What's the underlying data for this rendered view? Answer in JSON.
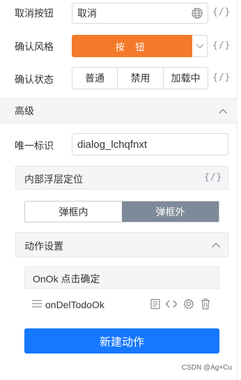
{
  "cancel_row": {
    "label": "取消按钮",
    "value": "取消",
    "globe_icon": "globe-icon",
    "code_icon": "{/}"
  },
  "style_row": {
    "label": "确认风格",
    "button_text": "按 钮",
    "code_icon": "{/}",
    "button_color": "#f47a2a"
  },
  "state_row": {
    "label": "确认状态",
    "options": [
      "普通",
      "禁用",
      "加载中"
    ],
    "code_icon": "{/}"
  },
  "advanced": {
    "title": "高级"
  },
  "uid_row": {
    "label": "唯一标识",
    "value": "dialog_lchqfnxt"
  },
  "float_panel": {
    "title": "内部浮层定位",
    "code_icon": "{/}",
    "options": [
      "弹框内",
      "弹框外"
    ],
    "selected": "弹框外"
  },
  "action_panel": {
    "title": "动作设置",
    "event_title": "OnOk 点击确定",
    "action_name": "onDelTodoOk",
    "new_action_button": "新建动作"
  },
  "watermark": "CSDN @Ag+Cu",
  "colors": {
    "primary": "#1677ff",
    "selected_toggle": "#7d8a99"
  }
}
